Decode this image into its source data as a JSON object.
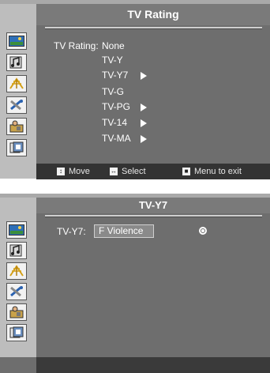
{
  "screen1": {
    "title": "TV Rating",
    "rating_label": "TV Rating:",
    "rating_value": "None",
    "items": [
      {
        "label": "TV-Y",
        "has_submenu": false
      },
      {
        "label": "TV-Y7",
        "has_submenu": true
      },
      {
        "label": "TV-G",
        "has_submenu": false
      },
      {
        "label": "TV-PG",
        "has_submenu": true
      },
      {
        "label": "TV-14",
        "has_submenu": true
      },
      {
        "label": "TV-MA",
        "has_submenu": true
      }
    ],
    "footer": {
      "move_label": "Move",
      "select_label": "Select",
      "menu_label": "Menu to exit"
    }
  },
  "screen2": {
    "title": "TV-Y7",
    "field_label": "TV-Y7:",
    "field_value": "F Violence"
  },
  "sidebar_icons": [
    "picture-icon",
    "sound-icon",
    "channel-icon",
    "setup-icon",
    "parental-lock-icon",
    "input-icon"
  ],
  "colors": {
    "panel": "#6e6e6e",
    "sidebar": "#bdbdbd",
    "title_bar": "#7a7a7a",
    "footer": "#333333",
    "text": "#ffffff"
  }
}
